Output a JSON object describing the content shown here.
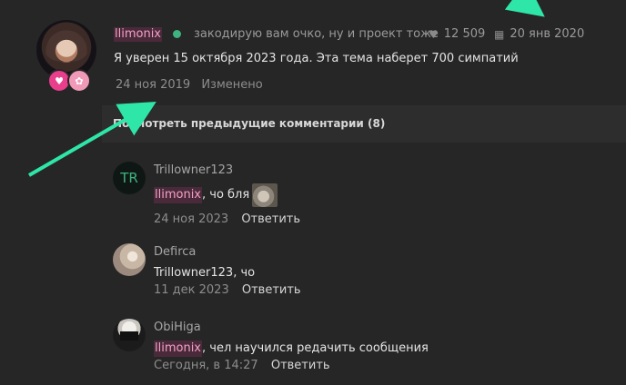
{
  "main_comment": {
    "author": "llimonix",
    "status": "закодирую вам очко, ну и проект тоже",
    "likes": "12 509",
    "joined": "20 янв 2020",
    "text": "Я уверен 15 октября 2023 года. Эта тема наберет 700 симпатий",
    "date": "24 ноя 2019",
    "edited_label": "Изменено"
  },
  "prev_comments": {
    "label": "Посмотреть предыдущие комментарии (8)"
  },
  "replies": [
    {
      "avatar_text": "TR",
      "author": "Trillowner123",
      "mention": "llimonix",
      "text": ", чо бля",
      "date": "24 ноя 2023",
      "reply_label": "Ответить"
    },
    {
      "author": "Defirca",
      "mention": "",
      "text": "Trillowner123, чо",
      "date": "11 дек 2023",
      "reply_label": "Ответить"
    },
    {
      "author": "ObiHiga",
      "mention": "llimonix",
      "text": ", чел научился редачить сообщения",
      "date": "Сегодня, в 14:27",
      "reply_label": "Ответить"
    }
  ],
  "icons": {
    "likes": "heart-icon",
    "joined": "calendar-icon",
    "badge1": "heart-badge-icon",
    "badge2": "star-badge-icon"
  },
  "colors": {
    "background": "#262626",
    "mention_text": "#f3a0c6",
    "online": "#3fb27f",
    "annotation_arrow": "#2ee6a8"
  }
}
